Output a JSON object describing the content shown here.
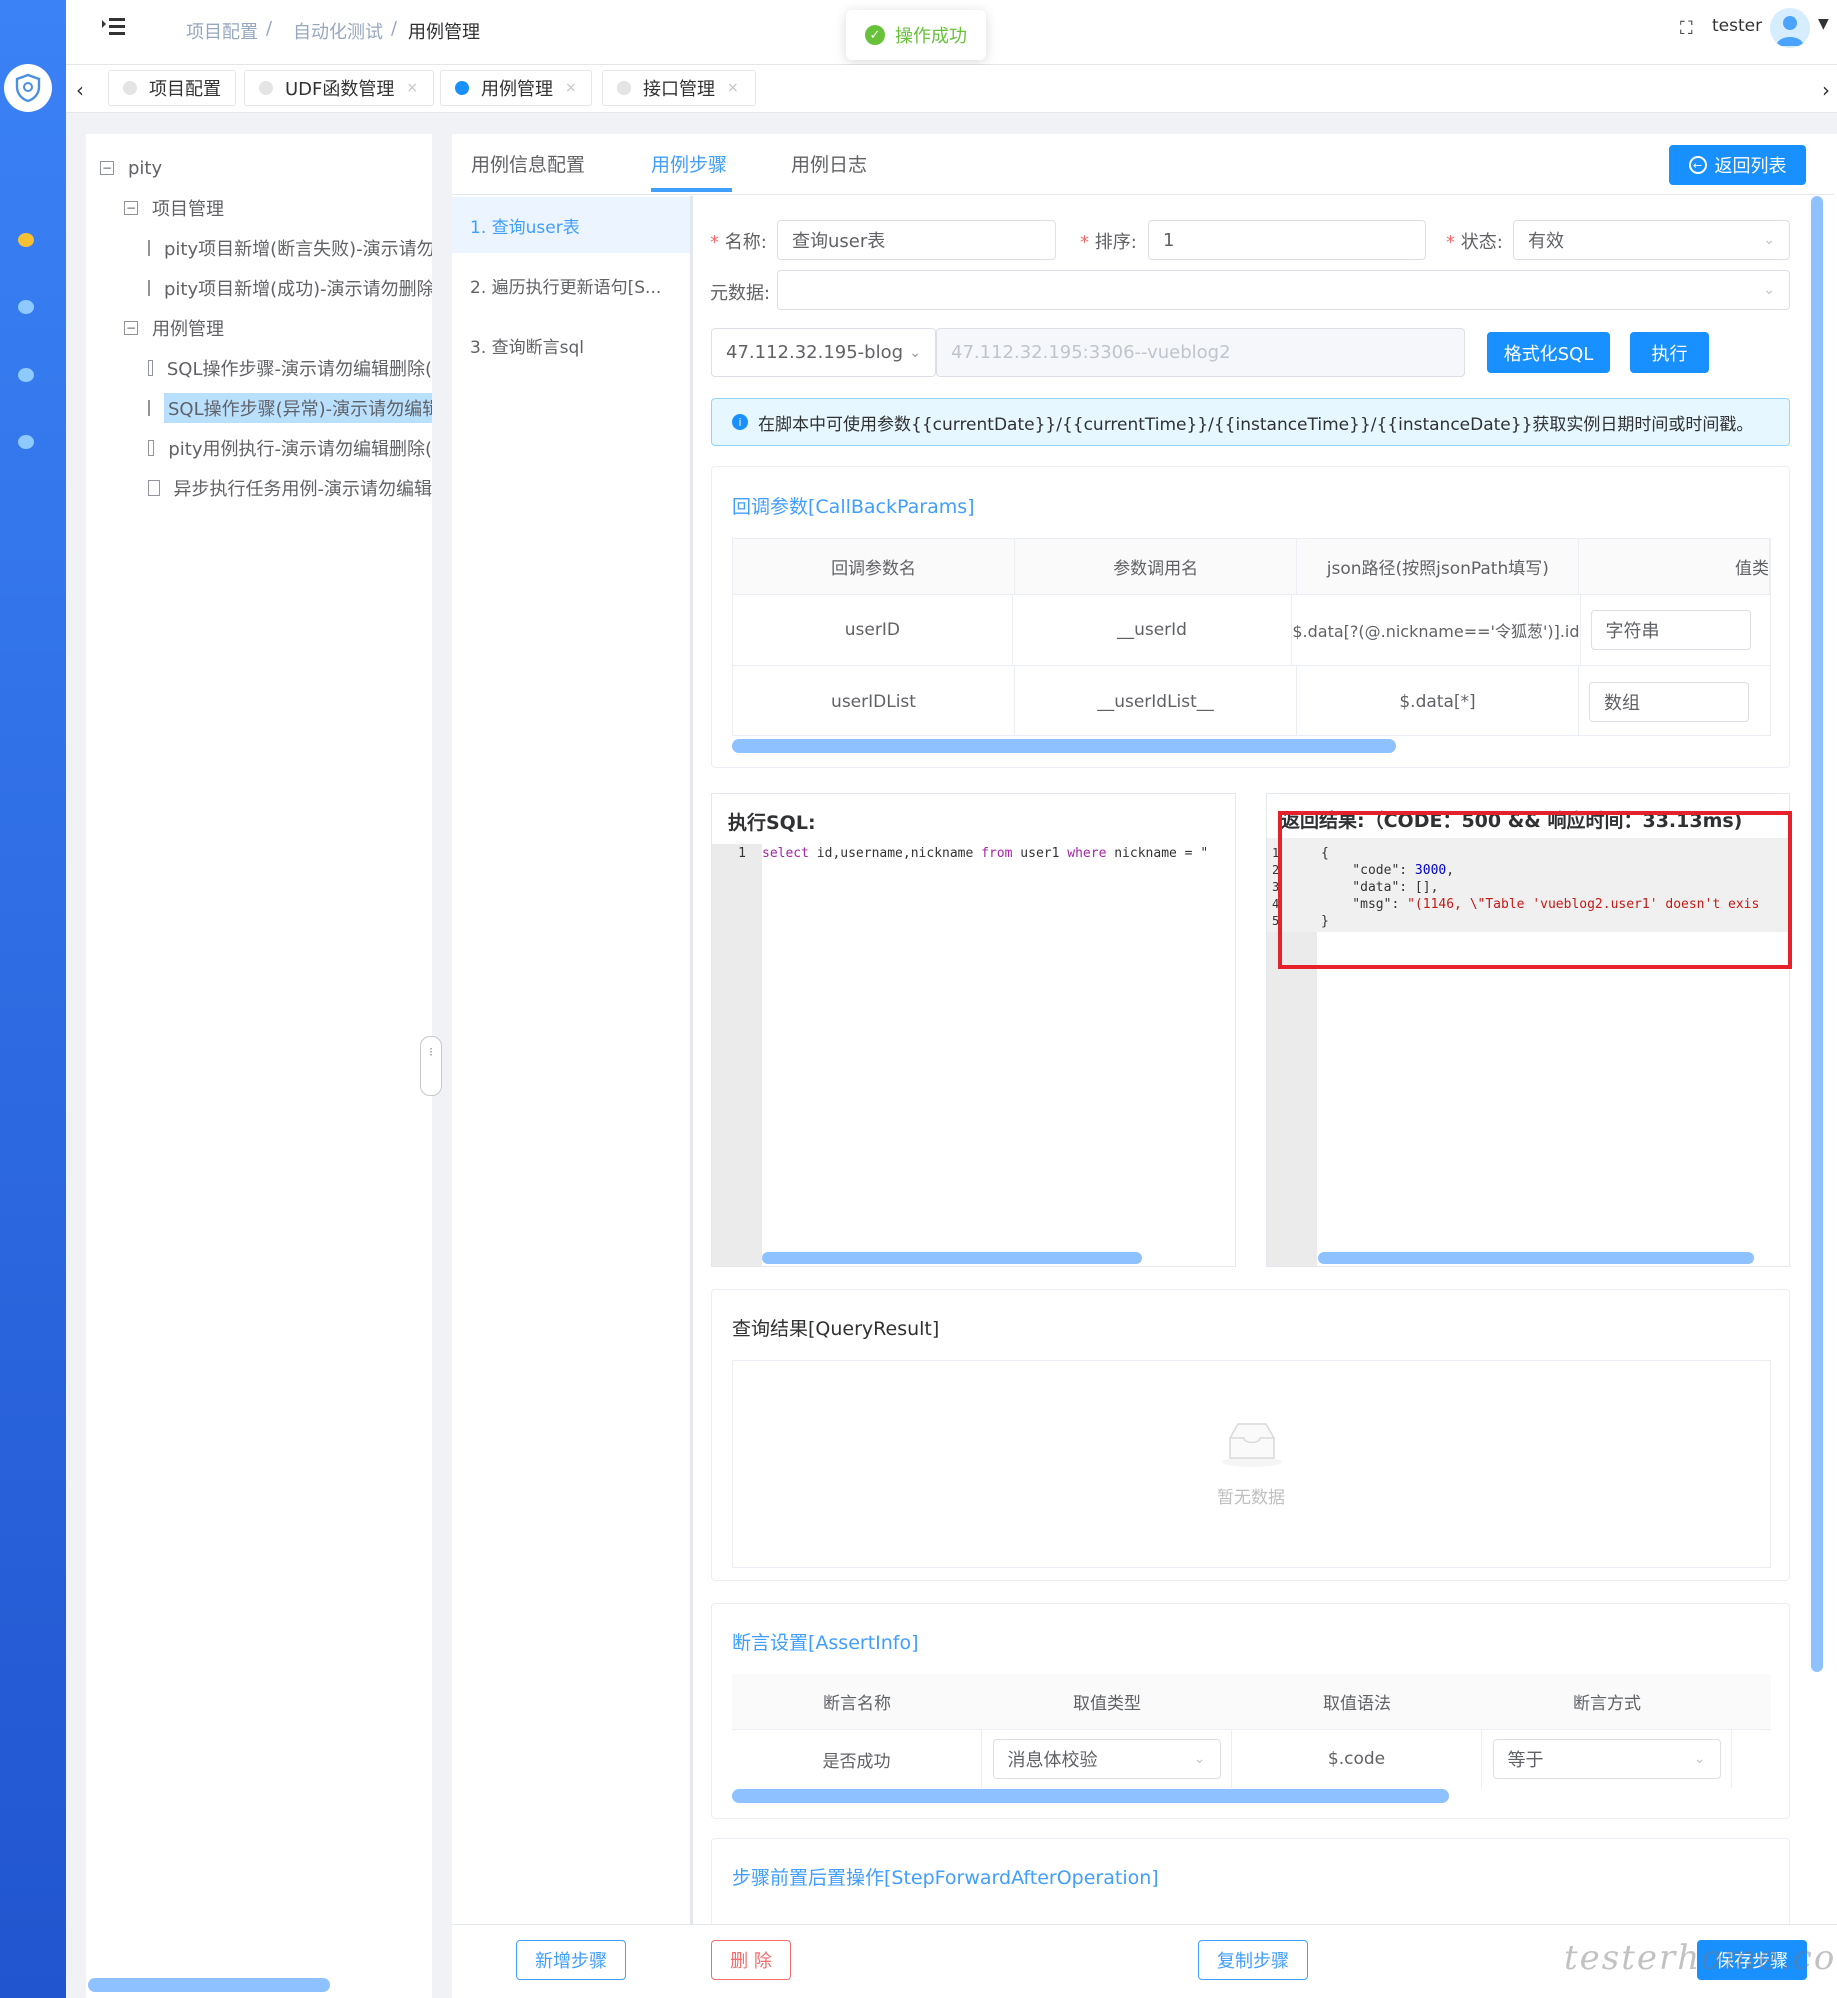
{
  "header": {
    "breadcrumb": [
      "项目配置",
      "自动化测试",
      "用例管理"
    ],
    "user": "tester",
    "toast": "操作成功"
  },
  "tags": [
    {
      "label": "项目配置"
    },
    {
      "label": "UDF函数管理"
    },
    {
      "label": "用例管理"
    },
    {
      "label": "接口管理"
    }
  ],
  "tree": {
    "root": "pity",
    "groups": [
      {
        "label": "项目管理",
        "items": [
          "pity项目新增(断言失败)-演示请勿",
          "pity项目新增(成功)-演示请勿删除"
        ]
      },
      {
        "label": "用例管理",
        "items": [
          "SQL操作步骤-演示请勿编辑删除(",
          "SQL操作步骤(异常)-演示请勿编辑",
          "pity用例执行-演示请勿编辑删除(",
          "异步执行任务用例-演示请勿编辑"
        ]
      }
    ]
  },
  "tabs": [
    "用例信息配置",
    "用例步骤",
    "用例日志"
  ],
  "back_button": "返回列表",
  "steps": [
    "1. 查询user表",
    "2. 遍历执行更新语句[S...",
    "3. 查询断言sql"
  ],
  "form": {
    "name_label": "名称:",
    "name_value": "查询user表",
    "order_label": "排序:",
    "order_value": "1",
    "status_label": "状态:",
    "status_value": "有效",
    "meta_label": "元数据:",
    "db_select": "47.112.32.195-blog",
    "db_placeholder": "47.112.32.195:3306--vueblog2",
    "format_button": "格式化SQL",
    "run_button": "执行"
  },
  "alert": "在脚本中可使用参数{{currentDate}}/{{currentTime}}/{{instanceTime}}/{{instanceDate}}获取实例日期时间或时间戳。",
  "callback": {
    "title": "回调参数[CallBackParams]",
    "headers": [
      "回调参数名",
      "参数调用名",
      "json路径(按照jsonPath填写)",
      "值类"
    ],
    "rows": [
      [
        "userID",
        "__userId",
        "$.data[?(@.nickname=='令狐葱')].id",
        "字符串"
      ],
      [
        "userIDList",
        "__userIdList__",
        "$.data[*]",
        "数组"
      ]
    ]
  },
  "sql": {
    "title": "执行SQL:",
    "line": "1",
    "code_keyword1": "select",
    "code_fields": " id,username,nickname ",
    "code_keyword2": "from",
    "code_table": " user1 ",
    "code_keyword3": "where",
    "code_rest": " nickname = \""
  },
  "result": {
    "title": "返回结果:（CODE：500 && 响应时间：33.13ms)",
    "lines": [
      "1",
      "2",
      "3",
      "4",
      "5"
    ],
    "l1": "{",
    "l2_key": "    \"code\": ",
    "l2_val": "3000",
    "l2_end": ",",
    "l3": "    \"data\": [],",
    "l4_key": "    \"msg\": ",
    "l4_val": "\"(1146, \\\"Table 'vueblog2.user1' doesn't exis",
    "l5": "}"
  },
  "query": {
    "title": "查询结果[QueryResult]",
    "empty": "暂无数据"
  },
  "assert": {
    "title": "断言设置[AssertInfo]",
    "headers": [
      "断言名称",
      "取值类型",
      "取值语法",
      "断言方式"
    ],
    "row": {
      "name": "是否成功",
      "type": "消息体校验",
      "syntax": "$.code",
      "method": "等于"
    }
  },
  "stepop": {
    "title": "步骤前置后置操作[StepForwardAfterOperation]"
  },
  "footer": {
    "add": "新增步骤",
    "delete": "删 除",
    "copy": "复制步骤",
    "save": "保存步骤"
  },
  "watermark": "testerhome.com",
  "colors": {
    "primary": "#1890ff",
    "link": "#409eff",
    "danger": "#f56c6c",
    "success": "#67c23a"
  }
}
